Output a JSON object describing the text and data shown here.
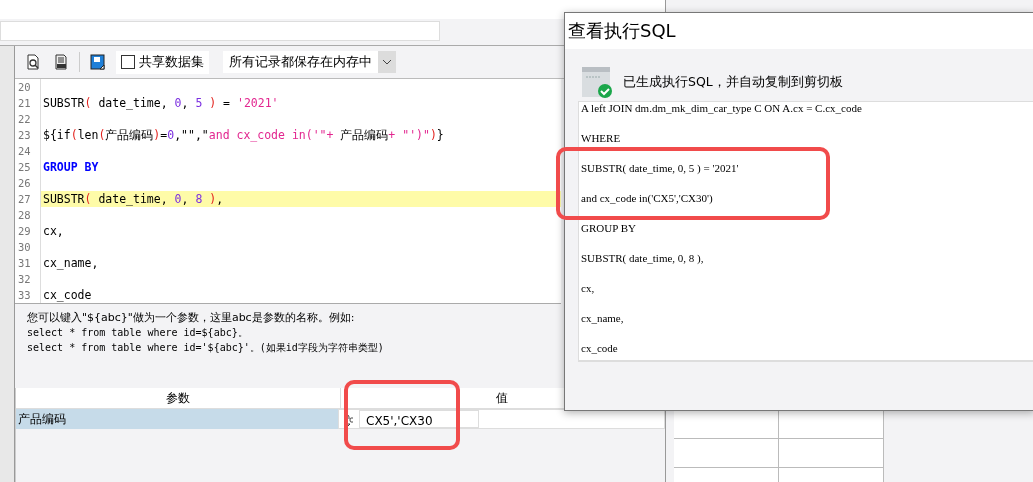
{
  "toolbar": {
    "share_checkbox": {
      "label": "共享数据集",
      "checked": false
    },
    "storage_select": {
      "value": "所有记录都保存在内存中"
    }
  },
  "code": {
    "lines": [
      {
        "number": "20",
        "highlighted": false
      },
      {
        "number": "21",
        "highlighted": false,
        "tokens": [
          {
            "kind": "plain",
            "text": "SUBSTR"
          },
          {
            "kind": "paren",
            "text": "( "
          },
          {
            "kind": "plain",
            "text": "date_time, "
          },
          {
            "kind": "number",
            "text": "0"
          },
          {
            "kind": "plain",
            "text": ", "
          },
          {
            "kind": "number",
            "text": "5"
          },
          {
            "kind": "paren",
            "text": " )"
          },
          {
            "kind": "plain",
            "text": " = "
          },
          {
            "kind": "string",
            "text": "'2021'"
          }
        ]
      },
      {
        "number": "22",
        "highlighted": false
      },
      {
        "number": "23",
        "highlighted": false,
        "tokens": [
          {
            "kind": "plain",
            "text": "${if"
          },
          {
            "kind": "paren",
            "text": "("
          },
          {
            "kind": "plain",
            "text": "len"
          },
          {
            "kind": "paren",
            "text": "("
          },
          {
            "kind": "plain",
            "text": "产品编码"
          },
          {
            "kind": "paren",
            "text": ")"
          },
          {
            "kind": "plain",
            "text": "="
          },
          {
            "kind": "number",
            "text": "0"
          },
          {
            "kind": "plain",
            "text": ",\"\",\""
          },
          {
            "kind": "string",
            "text": "and cx_code in('\"+"
          },
          {
            "kind": "plain",
            "text": " 产品编码"
          },
          {
            "kind": "string",
            "text": "+ \"')\""
          },
          {
            "kind": "paren",
            "text": ")"
          },
          {
            "kind": "plain",
            "text": "}"
          }
        ]
      },
      {
        "number": "24",
        "highlighted": false
      },
      {
        "number": "25",
        "highlighted": false,
        "tokens": [
          {
            "kind": "keyword",
            "text": "GROUP BY"
          }
        ]
      },
      {
        "number": "26",
        "highlighted": false
      },
      {
        "number": "27",
        "highlighted": true,
        "tokens": [
          {
            "kind": "plain",
            "text": "SUBSTR"
          },
          {
            "kind": "paren",
            "text": "( "
          },
          {
            "kind": "plain",
            "text": "date_time, "
          },
          {
            "kind": "number",
            "text": "0"
          },
          {
            "kind": "plain",
            "text": ", "
          },
          {
            "kind": "number",
            "text": "8"
          },
          {
            "kind": "paren",
            "text": " )"
          },
          {
            "kind": "plain",
            "text": ","
          }
        ]
      },
      {
        "number": "28",
        "highlighted": false
      },
      {
        "number": "29",
        "highlighted": false,
        "tokens": [
          {
            "kind": "plain",
            "text": "cx,"
          }
        ]
      },
      {
        "number": "30",
        "highlighted": false
      },
      {
        "number": "31",
        "highlighted": false,
        "tokens": [
          {
            "kind": "plain",
            "text": "cx_name,"
          }
        ]
      },
      {
        "number": "32",
        "highlighted": false
      },
      {
        "number": "33",
        "highlighted": false,
        "tokens": [
          {
            "kind": "plain",
            "text": "cx_code"
          }
        ]
      }
    ]
  },
  "help": [
    "您可以键入\"${abc}\"做为一个参数，这里abc是参数的名称。例如:",
    "select * from table where id=${abc}。",
    "select * from table where id='${abc}'。(如果id字段为字符串类型)"
  ],
  "params": {
    "columns": [
      "参数",
      "值"
    ],
    "rows": [
      {
        "name": "产品编码",
        "value": "CX5','CX30",
        "selected": true
      }
    ]
  },
  "dialog": {
    "title": "查看执行SQL",
    "message": "已生成执行SQL，并自动复制到剪切板",
    "sql_lines": [
      "A left JOIN dm.dm_mk_dim_car_type C ON A.cx = C.cx_code",
      "WHERE",
      "SUBSTR( date_time, 0, 5 ) = '2021'",
      "and cx_code in('CX5','CX30')",
      "GROUP BY",
      "SUBSTR( date_time, 0, 8 ),",
      "cx,",
      "cx_name,",
      "cx_code"
    ]
  }
}
